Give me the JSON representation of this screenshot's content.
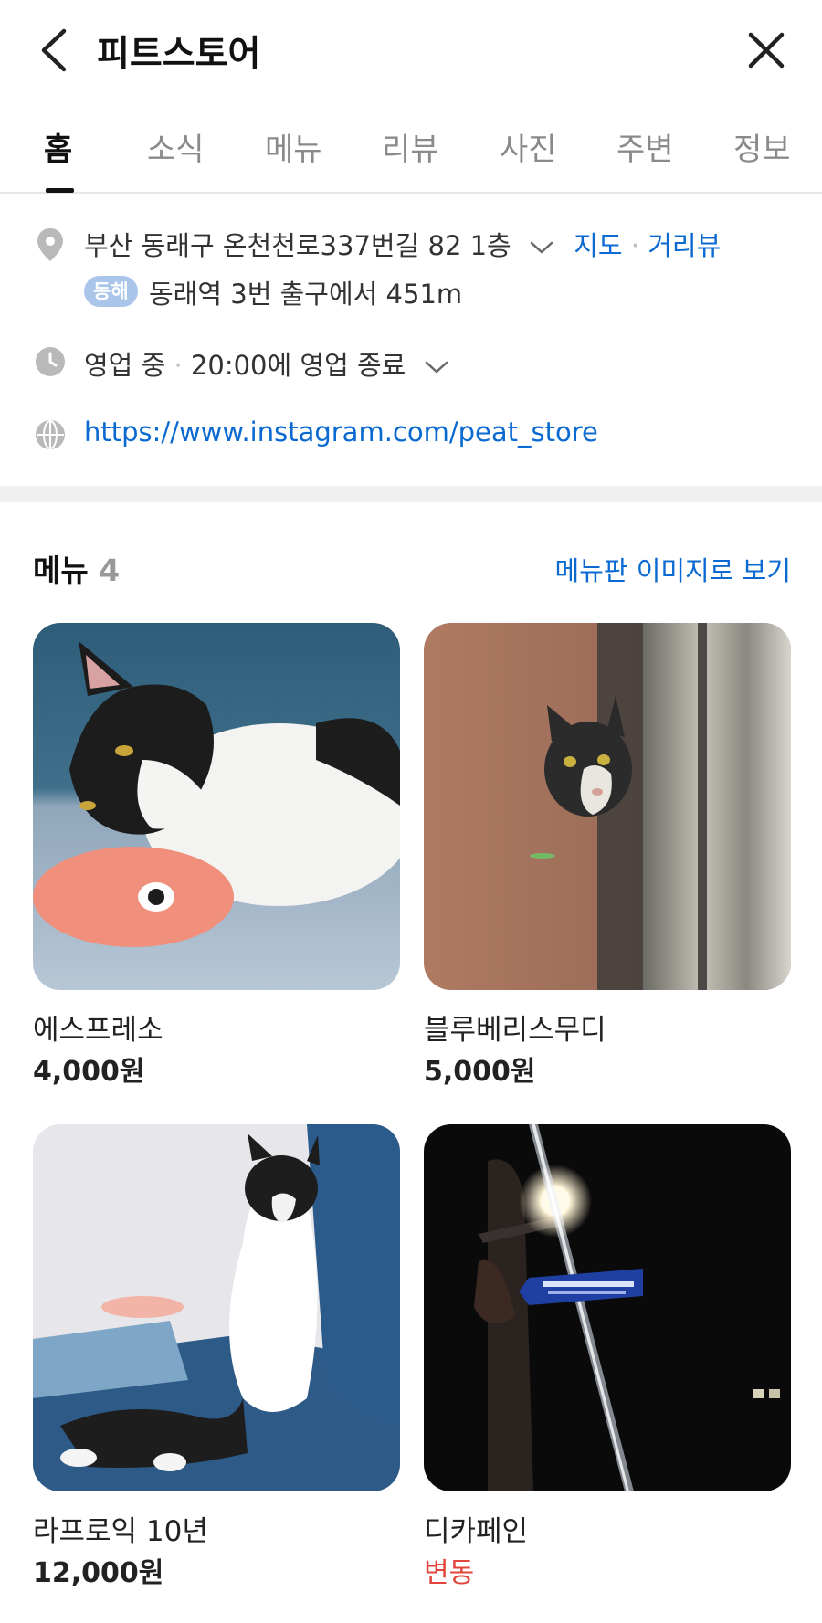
{
  "header": {
    "title": "피트스토어",
    "back_icon": "chevron-left-icon",
    "close_icon": "close-icon"
  },
  "tabs": [
    {
      "label": "홈",
      "active": true
    },
    {
      "label": "소식",
      "active": false
    },
    {
      "label": "메뉴",
      "active": false
    },
    {
      "label": "리뷰",
      "active": false
    },
    {
      "label": "사진",
      "active": false
    },
    {
      "label": "주변",
      "active": false
    },
    {
      "label": "정보",
      "active": false
    }
  ],
  "info": {
    "address": "부산 동래구 온천천로337번길 82 1층",
    "map_link": "지도",
    "street_view_link": "거리뷰",
    "line_badge": "동해",
    "line_badge_color": "#a9c6ea",
    "station_text": "동래역 3번 출구에서 451m",
    "status": "영업 중",
    "hours": "20:00에 영업 종료",
    "website": "https://www.instagram.com/peat_store"
  },
  "menu": {
    "heading": "메뉴",
    "count": "4",
    "board_link": "메뉴판 이미지로 보기",
    "items": [
      {
        "name": "에스프레소",
        "price": "4,000원"
      },
      {
        "name": "블루베리스무디",
        "price": "5,000원"
      },
      {
        "name": "라프로익 10년",
        "price": "12,000원"
      },
      {
        "name": "디카페인",
        "price": "변동"
      }
    ]
  },
  "colors": {
    "link": "#0a6ad1",
    "variable_price": "#e2453c"
  }
}
